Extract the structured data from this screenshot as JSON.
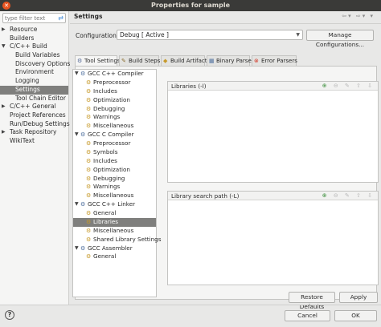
{
  "window": {
    "title": "Properties for sample",
    "close_glyph": "✕"
  },
  "filter": {
    "placeholder": "type filter text",
    "clear_glyph": "⇄"
  },
  "props_tree": [
    {
      "label": "Resource",
      "arrow": "▶",
      "depth": 0
    },
    {
      "label": "Builders",
      "arrow": "",
      "depth": 0
    },
    {
      "label": "C/C++ Build",
      "arrow": "▼",
      "depth": 0
    },
    {
      "label": "Build Variables",
      "arrow": "",
      "depth": 1
    },
    {
      "label": "Discovery Options",
      "arrow": "",
      "depth": 1
    },
    {
      "label": "Environment",
      "arrow": "",
      "depth": 1
    },
    {
      "label": "Logging",
      "arrow": "",
      "depth": 1
    },
    {
      "label": "Settings",
      "arrow": "",
      "depth": 1,
      "selected": true
    },
    {
      "label": "Tool Chain Editor",
      "arrow": "",
      "depth": 1
    },
    {
      "label": "C/C++ General",
      "arrow": "▶",
      "depth": 0
    },
    {
      "label": "Project References",
      "arrow": "",
      "depth": 0
    },
    {
      "label": "Run/Debug Settings",
      "arrow": "",
      "depth": 0
    },
    {
      "label": "Task Repository",
      "arrow": "▶",
      "depth": 0
    },
    {
      "label": "WikiText",
      "arrow": "",
      "depth": 0
    }
  ],
  "header": {
    "title": "Settings",
    "nav_icons": "⇦▾ ⇨▾ ▾"
  },
  "configuration": {
    "label": "Configuration:",
    "value": "Debug  [ Active ]",
    "manage_label": "Manage Configurations..."
  },
  "tabs": [
    {
      "label": "Tool Settings",
      "icon": "⚙",
      "color": "#5a6e9a",
      "active": true
    },
    {
      "label": "Build Steps",
      "icon": "✎",
      "color": "#8a6d2f"
    },
    {
      "label": "Build Artifact",
      "icon": "◆",
      "color": "#c79a2a"
    },
    {
      "label": "Binary Parsers",
      "icon": "▦",
      "color": "#4e6f9e"
    },
    {
      "label": "Error Parsers",
      "icon": "⊗",
      "color": "#d23b2b"
    }
  ],
  "tool_tree": [
    {
      "label": "GCC C++ Compiler",
      "kind": "tool",
      "depth": 0
    },
    {
      "label": "Preprocessor",
      "kind": "opt",
      "depth": 1
    },
    {
      "label": "Includes",
      "kind": "opt",
      "depth": 1
    },
    {
      "label": "Optimization",
      "kind": "opt",
      "depth": 1
    },
    {
      "label": "Debugging",
      "kind": "opt",
      "depth": 1
    },
    {
      "label": "Warnings",
      "kind": "opt",
      "depth": 1
    },
    {
      "label": "Miscellaneous",
      "kind": "opt",
      "depth": 1
    },
    {
      "label": "GCC C Compiler",
      "kind": "tool",
      "depth": 0
    },
    {
      "label": "Preprocessor",
      "kind": "opt",
      "depth": 1
    },
    {
      "label": "Symbols",
      "kind": "opt",
      "depth": 1
    },
    {
      "label": "Includes",
      "kind": "opt",
      "depth": 1
    },
    {
      "label": "Optimization",
      "kind": "opt",
      "depth": 1
    },
    {
      "label": "Debugging",
      "kind": "opt",
      "depth": 1
    },
    {
      "label": "Warnings",
      "kind": "opt",
      "depth": 1
    },
    {
      "label": "Miscellaneous",
      "kind": "opt",
      "depth": 1
    },
    {
      "label": "GCC C++ Linker",
      "kind": "tool",
      "depth": 0
    },
    {
      "label": "General",
      "kind": "opt",
      "depth": 1
    },
    {
      "label": "Libraries",
      "kind": "opt",
      "depth": 1,
      "selected": true
    },
    {
      "label": "Miscellaneous",
      "kind": "opt",
      "depth": 1
    },
    {
      "label": "Shared Library Settings",
      "kind": "opt",
      "depth": 1
    },
    {
      "label": "GCC Assembler",
      "kind": "tool",
      "depth": 0
    },
    {
      "label": "General",
      "kind": "opt",
      "depth": 1
    }
  ],
  "libraries_list": {
    "header": "Libraries (-l)"
  },
  "search_path_list": {
    "header": "Library search path (-L)"
  },
  "buttons": {
    "restore": "Restore Defaults",
    "apply": "Apply",
    "cancel": "Cancel",
    "ok": "OK",
    "help_glyph": "?"
  },
  "icons": {
    "tool": "⚙",
    "option": "⚙",
    "expand": "▼",
    "list_add": "⊕",
    "list_others": "⊖ ✎ ⇧ ⇩"
  },
  "colors": {
    "accent": "#e95420",
    "selection": "#7f7f7d",
    "tool_icon": "#4e6f9e",
    "option_icon": "#c79a2a",
    "list_add_icon": "#3b8f3b"
  }
}
